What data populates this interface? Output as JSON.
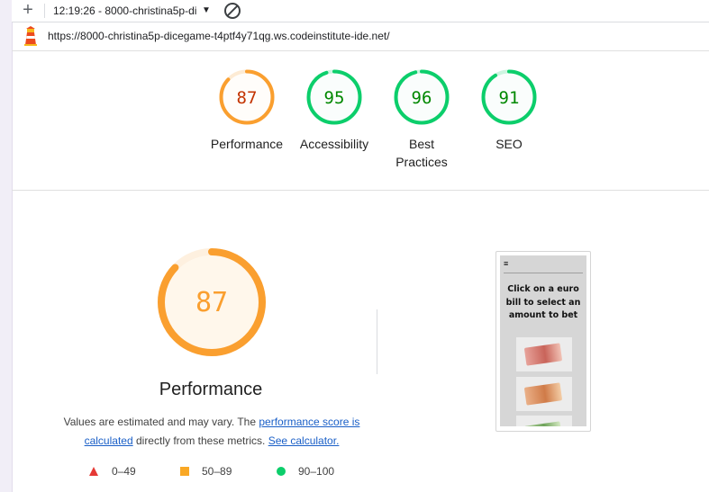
{
  "toolbar": {
    "new_label": "+",
    "report_select": "12:19:26 - 8000-christina5p-di",
    "caret": "▼"
  },
  "url": "https://8000-christina5p-dicegame-t4ptf4y71qg.ws.codeinstitute-ide.net/",
  "scores": [
    {
      "label": "Performance",
      "value": "87",
      "score": 87
    },
    {
      "label": "Accessibility",
      "value": "95",
      "score": 95
    },
    {
      "label": "Best Practices",
      "value": "96",
      "score": 96
    },
    {
      "label": "SEO",
      "value": "91",
      "score": 91
    }
  ],
  "performance": {
    "value": "87",
    "score": 87,
    "title": "Performance",
    "desc_prefix": "Values are estimated and may vary. The ",
    "desc_link1": "performance score is calculated",
    "desc_mid": " directly from these metrics. ",
    "desc_link2": "See calculator."
  },
  "legend": [
    {
      "range": "0–49",
      "shape": "triangle",
      "color": "#e53935"
    },
    {
      "range": "50–89",
      "shape": "square",
      "color": "#f9a825"
    },
    {
      "range": "90–100",
      "shape": "circle",
      "color": "#0cce6b"
    }
  ],
  "screenshot": {
    "menu_icon": "≡",
    "text": "Click on a euro bill to select an amount to bet"
  },
  "colors": {
    "average": "#fa9f2f",
    "average_text": "#c33300",
    "average_bg": "#fff7eb",
    "pass": "#0cce6b",
    "pass_text": "#008800",
    "pass_bg": "#eafaf1"
  }
}
